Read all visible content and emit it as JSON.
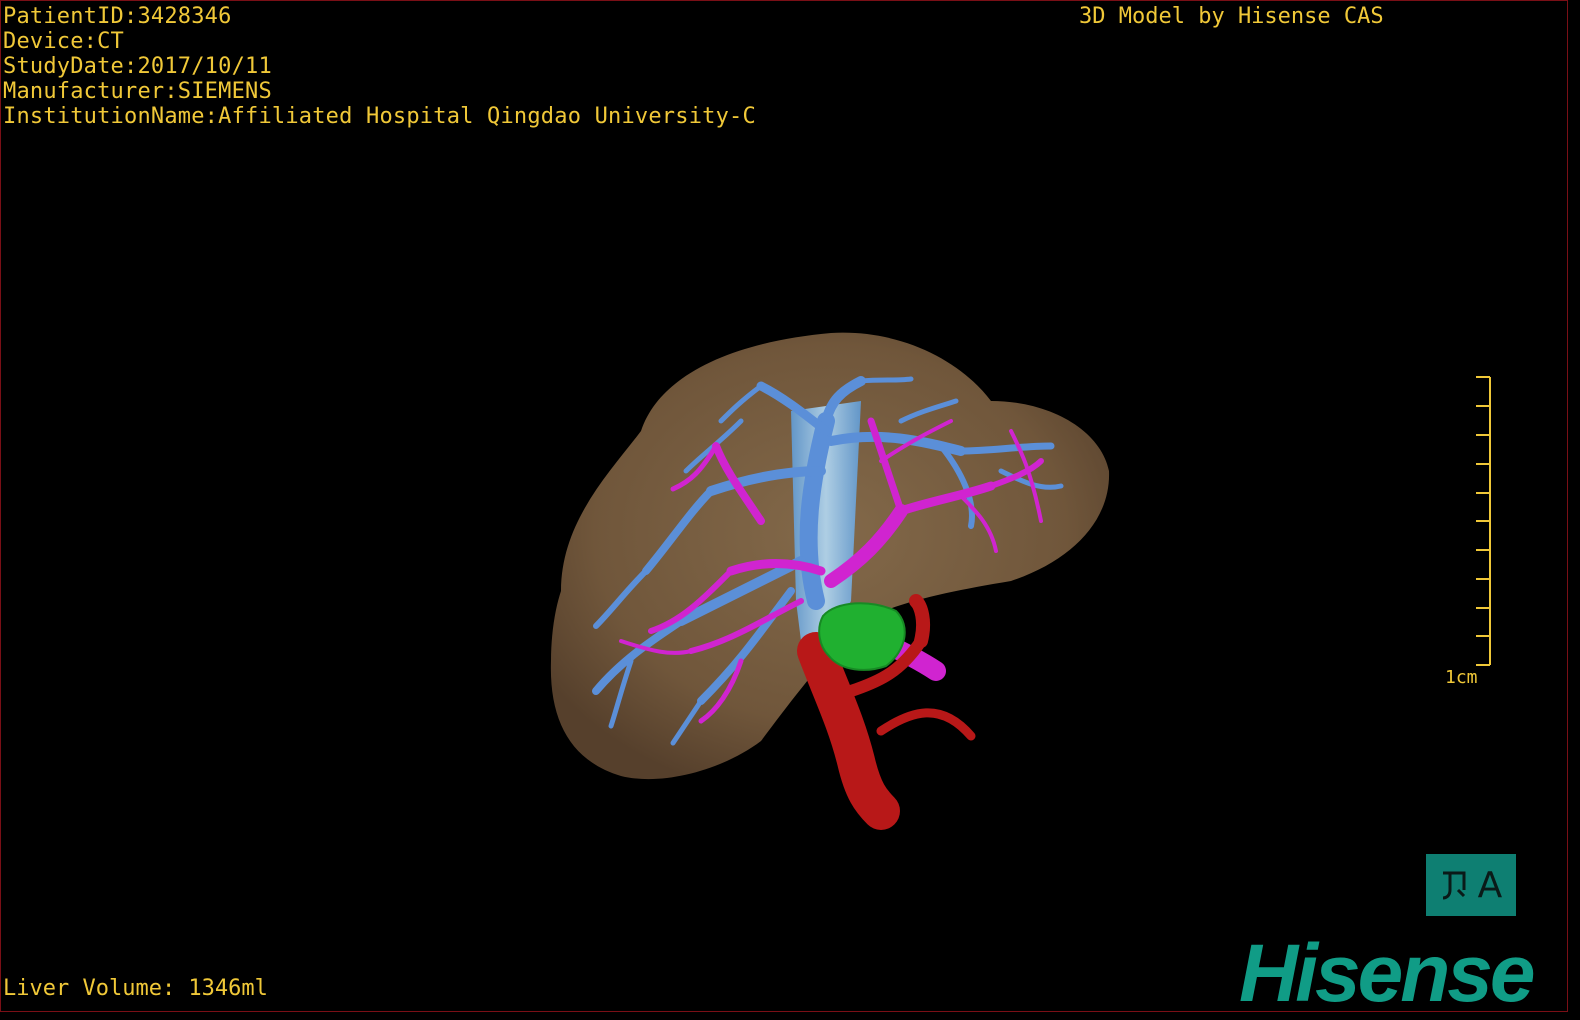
{
  "header": {
    "patient_id": "PatientID:3428346",
    "device": "Device:CT",
    "study_date": "StudyDate:2017/10/11",
    "manufacturer": "Manufacturer:SIEMENS",
    "institution": "InstitutionName:Affiliated Hospital Qingdao University-C"
  },
  "model_credit": "3D Model by Hisense CAS",
  "footer": {
    "liver_volume": "Liver Volume: 1346ml"
  },
  "scale": {
    "label": "1cm"
  },
  "view_toggle": {
    "icon": "view-orientation-icon",
    "letter": "A"
  },
  "brand": {
    "logo_text": "Hisense"
  },
  "colors": {
    "overlay_text": "#f0c838",
    "liver": "#8a6c4a",
    "portal_vein": "#5b8fd8",
    "hepatic_vein": "#d024d0",
    "ivc": "#8cc8f0",
    "artery": "#b81818",
    "tumor": "#20b030",
    "brand": "#109c86"
  }
}
